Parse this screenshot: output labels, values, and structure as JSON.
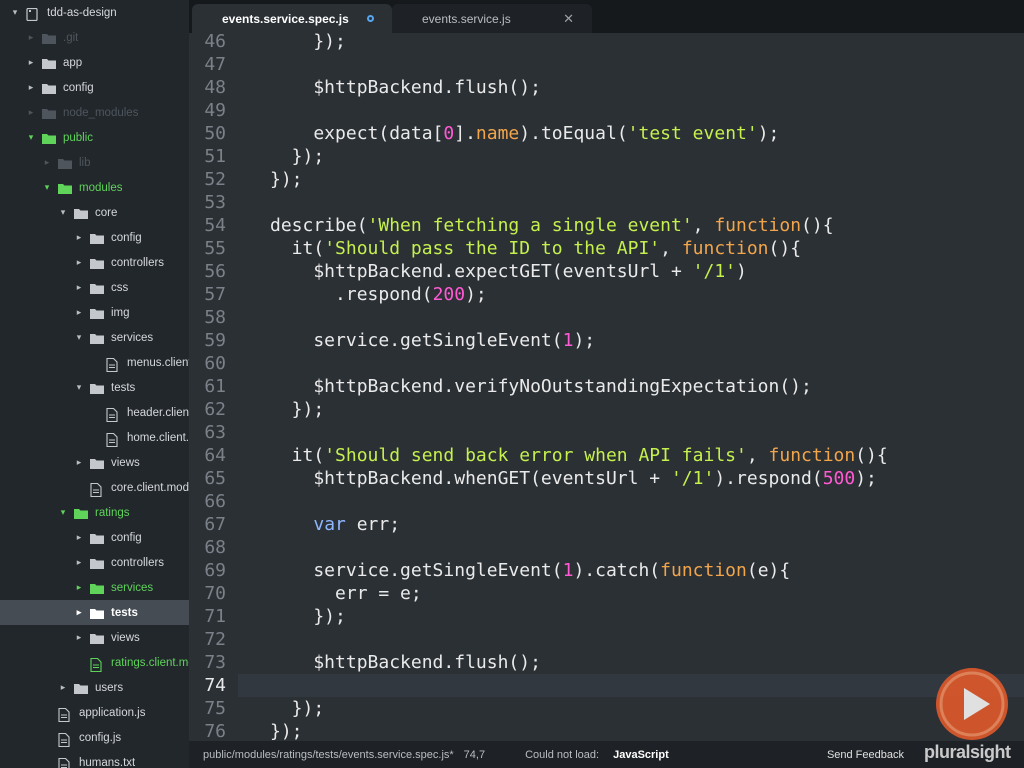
{
  "sidebar": {
    "items": [
      {
        "label": "tdd-as-design",
        "depth": 0,
        "arrow": "down",
        "icon": "repo",
        "style": "normal"
      },
      {
        "label": ".git",
        "depth": 1,
        "arrow": "right",
        "icon": "folder",
        "style": "dim"
      },
      {
        "label": "app",
        "depth": 1,
        "arrow": "right",
        "icon": "folder",
        "style": "normal"
      },
      {
        "label": "config",
        "depth": 1,
        "arrow": "right",
        "icon": "folder",
        "style": "normal"
      },
      {
        "label": "node_modules",
        "depth": 1,
        "arrow": "right",
        "icon": "folder",
        "style": "dim"
      },
      {
        "label": "public",
        "depth": 1,
        "arrow": "down",
        "icon": "folder",
        "style": "green"
      },
      {
        "label": "lib",
        "depth": 2,
        "arrow": "right",
        "icon": "folder",
        "style": "dim"
      },
      {
        "label": "modules",
        "depth": 2,
        "arrow": "down",
        "icon": "folder",
        "style": "green"
      },
      {
        "label": "core",
        "depth": 3,
        "arrow": "down",
        "icon": "folder",
        "style": "normal"
      },
      {
        "label": "config",
        "depth": 4,
        "arrow": "right",
        "icon": "folder",
        "style": "normal"
      },
      {
        "label": "controllers",
        "depth": 4,
        "arrow": "right",
        "icon": "folder",
        "style": "normal"
      },
      {
        "label": "css",
        "depth": 4,
        "arrow": "right",
        "icon": "folder",
        "style": "normal"
      },
      {
        "label": "img",
        "depth": 4,
        "arrow": "right",
        "icon": "folder",
        "style": "normal"
      },
      {
        "label": "services",
        "depth": 4,
        "arrow": "down",
        "icon": "folder",
        "style": "normal"
      },
      {
        "label": "menus.client.services.js",
        "depth": 5,
        "arrow": "",
        "icon": "file",
        "style": "normal"
      },
      {
        "label": "tests",
        "depth": 4,
        "arrow": "down",
        "icon": "folder",
        "style": "normal"
      },
      {
        "label": "header.client.controller.test.js",
        "depth": 5,
        "arrow": "",
        "icon": "file",
        "style": "normal"
      },
      {
        "label": "home.client.controller.test.js",
        "depth": 5,
        "arrow": "",
        "icon": "file",
        "style": "normal"
      },
      {
        "label": "views",
        "depth": 4,
        "arrow": "right",
        "icon": "folder",
        "style": "normal"
      },
      {
        "label": "core.client.module.js",
        "depth": 4,
        "arrow": "",
        "icon": "file",
        "style": "normal"
      },
      {
        "label": "ratings",
        "depth": 3,
        "arrow": "down",
        "icon": "folder",
        "style": "green"
      },
      {
        "label": "config",
        "depth": 4,
        "arrow": "right",
        "icon": "folder",
        "style": "normal"
      },
      {
        "label": "controllers",
        "depth": 4,
        "arrow": "right",
        "icon": "folder",
        "style": "normal"
      },
      {
        "label": "services",
        "depth": 4,
        "arrow": "right",
        "icon": "folder",
        "style": "green"
      },
      {
        "label": "tests",
        "depth": 4,
        "arrow": "right",
        "icon": "folder",
        "style": "selected"
      },
      {
        "label": "views",
        "depth": 4,
        "arrow": "right",
        "icon": "folder",
        "style": "normal"
      },
      {
        "label": "ratings.client.module.js",
        "depth": 4,
        "arrow": "",
        "icon": "file",
        "style": "green"
      },
      {
        "label": "users",
        "depth": 3,
        "arrow": "right",
        "icon": "folder",
        "style": "normal"
      },
      {
        "label": "application.js",
        "depth": 2,
        "arrow": "",
        "icon": "file",
        "style": "normal"
      },
      {
        "label": "config.js",
        "depth": 2,
        "arrow": "",
        "icon": "file",
        "style": "normal"
      },
      {
        "label": "humans.txt",
        "depth": 2,
        "arrow": "",
        "icon": "file",
        "style": "normal"
      }
    ]
  },
  "tabs": [
    {
      "label": "events.service.spec.js",
      "active": true,
      "icon": "modified-dot-icon"
    },
    {
      "label": "events.service.js",
      "active": false,
      "icon": "close-icon"
    }
  ],
  "editor": {
    "current_line": "74",
    "lines": [
      {
        "num": "46",
        "tokens": [
          [
            "    });",
            "plain"
          ]
        ]
      },
      {
        "num": "47",
        "tokens": []
      },
      {
        "num": "48",
        "tokens": [
          [
            "    $httpBackend.flush();",
            "plain"
          ]
        ]
      },
      {
        "num": "49",
        "tokens": []
      },
      {
        "num": "50",
        "tokens": [
          [
            "    expect(data[",
            "plain"
          ],
          [
            "0",
            "num"
          ],
          [
            "].",
            "plain"
          ],
          [
            "name",
            "fn"
          ],
          [
            ").toEqual(",
            "plain"
          ],
          [
            "'test event'",
            "str"
          ],
          [
            ");",
            "plain"
          ]
        ]
      },
      {
        "num": "51",
        "tokens": [
          [
            "  });",
            "plain"
          ]
        ]
      },
      {
        "num": "52",
        "tokens": [
          [
            "});",
            "plain"
          ]
        ]
      },
      {
        "num": "53",
        "tokens": []
      },
      {
        "num": "54",
        "tokens": [
          [
            "describe(",
            "plain"
          ],
          [
            "'When fetching a single event'",
            "str"
          ],
          [
            ", ",
            "plain"
          ],
          [
            "function",
            "fn"
          ],
          [
            "(){",
            "plain"
          ]
        ]
      },
      {
        "num": "55",
        "tokens": [
          [
            "  it(",
            "plain"
          ],
          [
            "'Should pass the ID to the API'",
            "str"
          ],
          [
            ", ",
            "plain"
          ],
          [
            "function",
            "fn"
          ],
          [
            "(){",
            "plain"
          ]
        ]
      },
      {
        "num": "56",
        "tokens": [
          [
            "    $httpBackend.expectGET(eventsUrl + ",
            "plain"
          ],
          [
            "'/1'",
            "str"
          ],
          [
            ")",
            "plain"
          ]
        ]
      },
      {
        "num": "57",
        "tokens": [
          [
            "      .respond(",
            "plain"
          ],
          [
            "200",
            "num"
          ],
          [
            ");",
            "plain"
          ]
        ]
      },
      {
        "num": "58",
        "tokens": []
      },
      {
        "num": "59",
        "tokens": [
          [
            "    service.getSingleEvent(",
            "plain"
          ],
          [
            "1",
            "num"
          ],
          [
            ");",
            "plain"
          ]
        ]
      },
      {
        "num": "60",
        "tokens": []
      },
      {
        "num": "61",
        "tokens": [
          [
            "    $httpBackend.verifyNoOutstandingExpectation();",
            "plain"
          ]
        ]
      },
      {
        "num": "62",
        "tokens": [
          [
            "  });",
            "plain"
          ]
        ]
      },
      {
        "num": "63",
        "tokens": []
      },
      {
        "num": "64",
        "tokens": [
          [
            "  it(",
            "plain"
          ],
          [
            "'Should send back error when API fails'",
            "str"
          ],
          [
            ", ",
            "plain"
          ],
          [
            "function",
            "fn"
          ],
          [
            "(){",
            "plain"
          ]
        ]
      },
      {
        "num": "65",
        "tokens": [
          [
            "    $httpBackend.whenGET(eventsUrl + ",
            "plain"
          ],
          [
            "'/1'",
            "str"
          ],
          [
            ").respond(",
            "plain"
          ],
          [
            "500",
            "num"
          ],
          [
            ");",
            "plain"
          ]
        ]
      },
      {
        "num": "66",
        "tokens": []
      },
      {
        "num": "67",
        "tokens": [
          [
            "    ",
            "plain"
          ],
          [
            "var",
            "kw"
          ],
          [
            " err;",
            "plain"
          ]
        ]
      },
      {
        "num": "68",
        "tokens": []
      },
      {
        "num": "69",
        "tokens": [
          [
            "    service.getSingleEvent(",
            "plain"
          ],
          [
            "1",
            "num"
          ],
          [
            ").catch(",
            "plain"
          ],
          [
            "function",
            "fn"
          ],
          [
            "(e){",
            "plain"
          ]
        ]
      },
      {
        "num": "70",
        "tokens": [
          [
            "      err = e;",
            "plain"
          ]
        ]
      },
      {
        "num": "71",
        "tokens": [
          [
            "    });",
            "plain"
          ]
        ]
      },
      {
        "num": "72",
        "tokens": []
      },
      {
        "num": "73",
        "tokens": [
          [
            "    $httpBackend.flush();",
            "plain"
          ]
        ]
      },
      {
        "num": "74",
        "tokens": []
      },
      {
        "num": "75",
        "tokens": [
          [
            "  });",
            "plain"
          ]
        ]
      },
      {
        "num": "76",
        "tokens": [
          [
            "});",
            "plain"
          ]
        ]
      }
    ]
  },
  "status": {
    "path": "public/modules/ratings/tests/events.service.spec.js*",
    "position": "74,7",
    "message": "Could not load:",
    "language": "JavaScript",
    "feedback": "Send Feedback"
  },
  "watermark": {
    "brand": "pluralsight"
  },
  "colors": {
    "sidebar_bg": "#22272c",
    "editor_bg": "#2b3035",
    "tab_bar_bg": "#16191c",
    "string": "#c5f04d",
    "number": "#ff5ad4",
    "keyword": "#8fb6ff",
    "function": "#f2a54b",
    "accent_green": "#5fd35a",
    "brand_orange": "#e05a2a"
  }
}
